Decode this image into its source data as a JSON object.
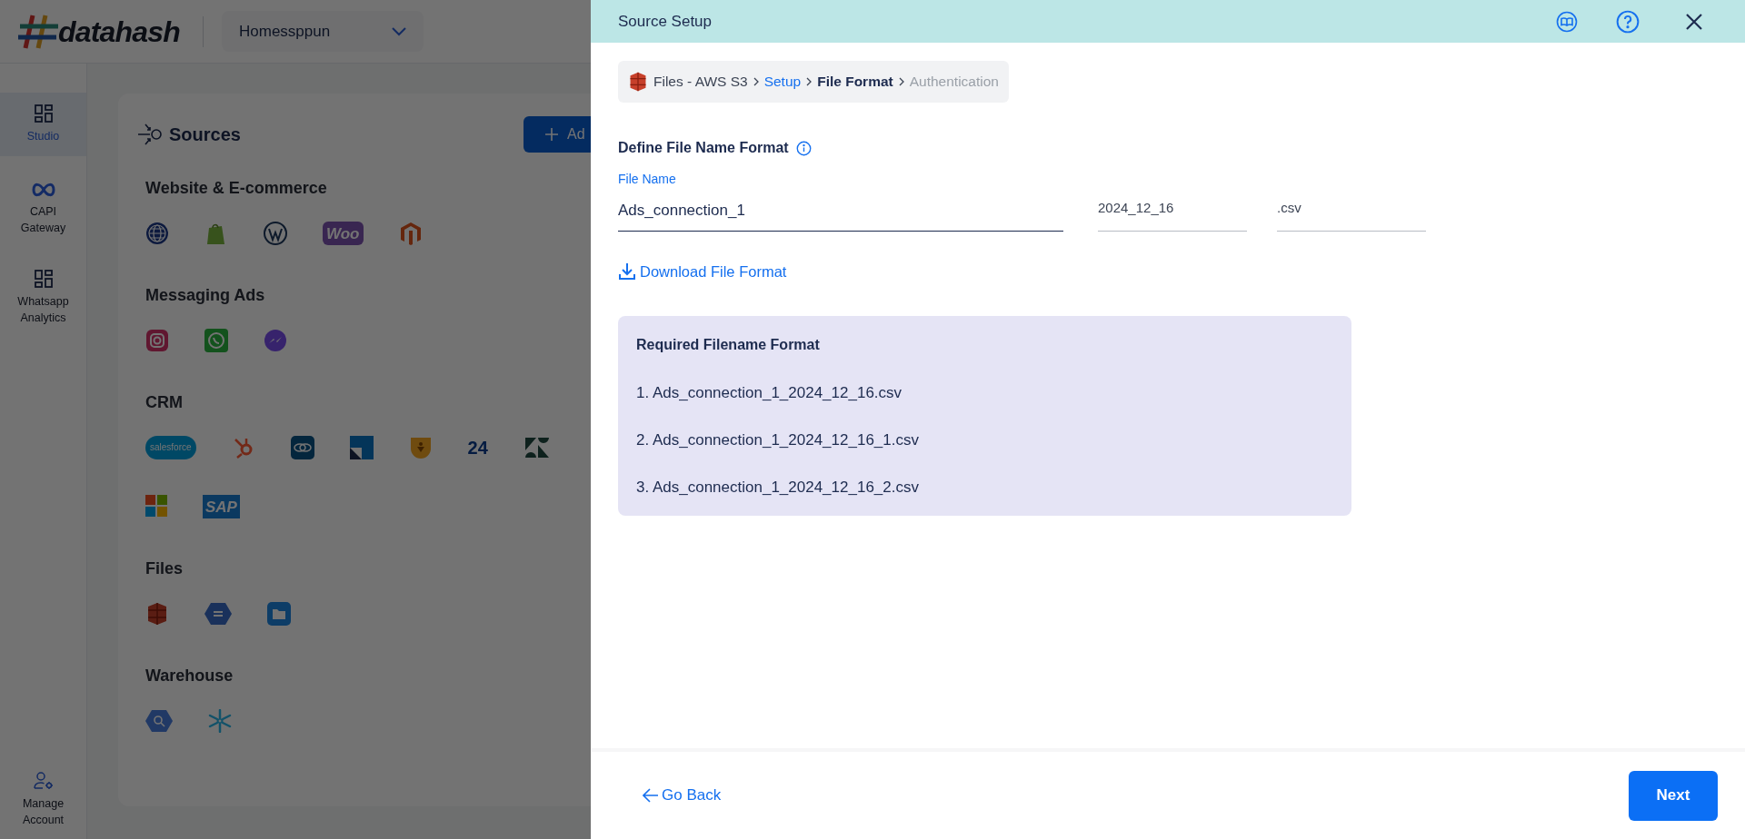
{
  "app": {
    "logo": "datahash",
    "workspace": "Homessppun"
  },
  "sidebar": {
    "items": [
      {
        "label": "Studio",
        "selected": true
      },
      {
        "label": "CAPI Gateway",
        "selected": false
      },
      {
        "label": "Whatsapp Analytics",
        "selected": false
      }
    ],
    "footer_item": {
      "label": "Manage Account"
    }
  },
  "sources": {
    "title": "Sources",
    "add_button": "Ad",
    "sections": [
      {
        "title": "Website & E-commerce",
        "icons": [
          {
            "kind": "globe"
          },
          {
            "kind": "bag"
          },
          {
            "kind": "wordpress"
          },
          {
            "kind": "woo",
            "text": "Woo"
          },
          {
            "kind": "magento"
          }
        ]
      },
      {
        "title": "Messaging Ads",
        "icons": [
          {
            "kind": "instagram"
          },
          {
            "kind": "whatsapp"
          },
          {
            "kind": "messenger"
          }
        ]
      },
      {
        "title": "CRM",
        "icons": [
          {
            "kind": "salesforce",
            "text": "salesforce"
          },
          {
            "kind": "hubspot"
          },
          {
            "kind": "links"
          },
          {
            "kind": "square"
          },
          {
            "kind": "shield"
          },
          {
            "kind": "clock24",
            "text": "24"
          },
          {
            "kind": "zendesk"
          },
          {
            "kind": "windows"
          },
          {
            "kind": "sap",
            "text": "SAP"
          }
        ]
      },
      {
        "title": "Files",
        "icons": [
          {
            "kind": "s3"
          },
          {
            "kind": "hexdoc"
          },
          {
            "kind": "folder"
          }
        ]
      },
      {
        "title": "Warehouse",
        "icons": [
          {
            "kind": "bigquery"
          },
          {
            "kind": "snowflake"
          }
        ]
      }
    ]
  },
  "panel": {
    "title": "Source Setup",
    "breadcrumb": [
      {
        "kind": "source",
        "label": "Files - AWS S3"
      },
      {
        "kind": "step",
        "label": "Setup",
        "selected": false,
        "disabled": false
      },
      {
        "kind": "step",
        "label": "File Format",
        "selected": true,
        "disabled": false
      },
      {
        "kind": "step",
        "label": "Authentication",
        "selected": false,
        "disabled": true
      }
    ],
    "section_title": "Define File Name Format",
    "fields": [
      {
        "label": "File Name",
        "value": "Ads_connection_1",
        "focused": true
      },
      {
        "value": "2024_12_16",
        "focused": false
      },
      {
        "value": ".csv",
        "focused": false
      }
    ],
    "download_link": "Download File Format",
    "format_box": {
      "title": "Required Filename Format",
      "lines": [
        "1. Ads_connection_1_2024_12_16.csv",
        "2. Ads_connection_1_2024_12_16_1.csv",
        "3. Ads_connection_1_2024_12_16_2.csv"
      ]
    },
    "back_button": "Go Back",
    "next_button": "Next"
  }
}
